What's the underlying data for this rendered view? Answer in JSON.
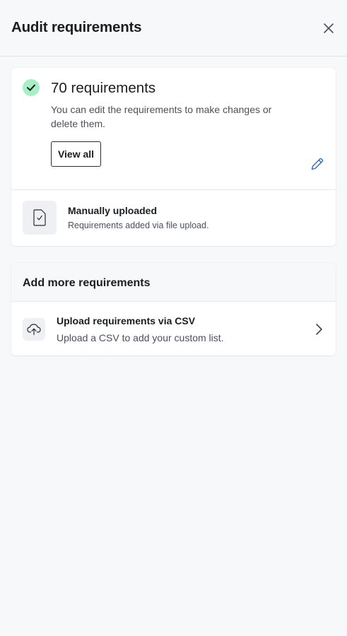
{
  "header": {
    "title": "Audit requirements",
    "close_icon": "close-icon"
  },
  "summary": {
    "count_text": "70 requirements",
    "description": "You can edit the requirements to make changes or delete them.",
    "view_all_label": "View all",
    "status_icon": "check-icon",
    "status_color": "#a7f0c5"
  },
  "source": {
    "title": "Manually uploaded",
    "subtitle": "Requirements added via file upload.",
    "icon": "document-check-icon",
    "edit_icon": "pencil-icon",
    "edit_color": "#2f6db3"
  },
  "add_more": {
    "title": "Add more requirements",
    "option": {
      "title": "Upload requirements via CSV",
      "subtitle": "Upload a CSV to add your custom list.",
      "icon": "cloud-upload-icon",
      "chevron_icon": "chevron-right-icon"
    }
  }
}
